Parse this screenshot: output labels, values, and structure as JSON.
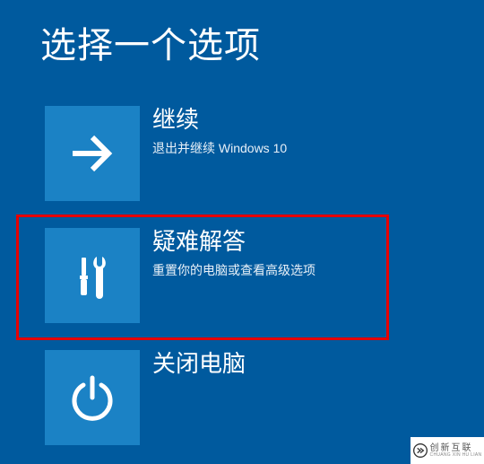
{
  "page_title": "选择一个选项",
  "options": {
    "continue": {
      "title": "继续",
      "subtitle": "退出并继续 Windows 10",
      "icon": "arrow-right-icon"
    },
    "troubleshoot": {
      "title": "疑难解答",
      "subtitle": "重置你的电脑或查看高级选项",
      "icon": "tools-icon"
    },
    "shutdown": {
      "title": "关闭电脑",
      "subtitle": "",
      "icon": "power-icon"
    }
  },
  "watermark": {
    "cn": "创新互联",
    "en": "CHUANG XIN HU LIAN"
  },
  "colors": {
    "background": "#005a9e",
    "tile": "#1b82c5",
    "highlight": "#e60000"
  }
}
